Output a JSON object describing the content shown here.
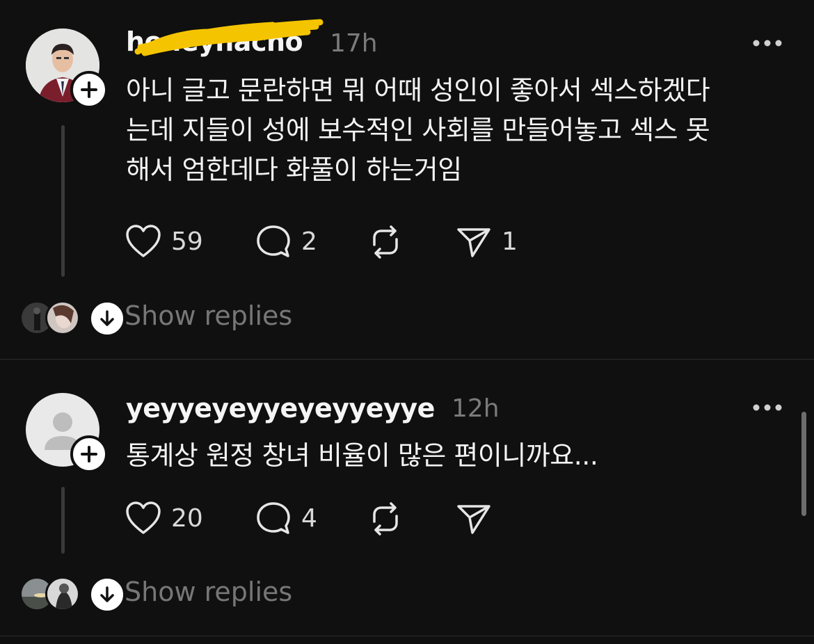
{
  "posts": [
    {
      "username": "honeyhacho",
      "time": "17h",
      "body": "아니 글고 문란하면 뭐 어때 성인이 좋아서 섹스하겠다\n는데 지들이 성에 보수적인 사회를 만들어놓고 섹스 못\n해서 엄한데다 화풀이 하는거임",
      "likes": "59",
      "replies": "2",
      "shares": "1",
      "show_replies": "Show replies"
    },
    {
      "username": "yeyyeyeyyeyeyyeyye",
      "time": "12h",
      "body": "통계상 원정 창녀 비율이 많은 편이니까요...",
      "likes": "20",
      "replies": "4",
      "shares": "",
      "show_replies": "Show replies"
    }
  ],
  "icons": {
    "like": "heart-icon",
    "reply": "speech-bubble-icon",
    "repost": "repost-icon",
    "share": "send-icon",
    "more": "more-icon",
    "follow": "plus-icon",
    "expand": "arrow-down-icon"
  },
  "colors": {
    "background": "#101010",
    "text": "#f3f3f3",
    "muted": "#7b7b7b",
    "redaction": "#f5c400"
  }
}
